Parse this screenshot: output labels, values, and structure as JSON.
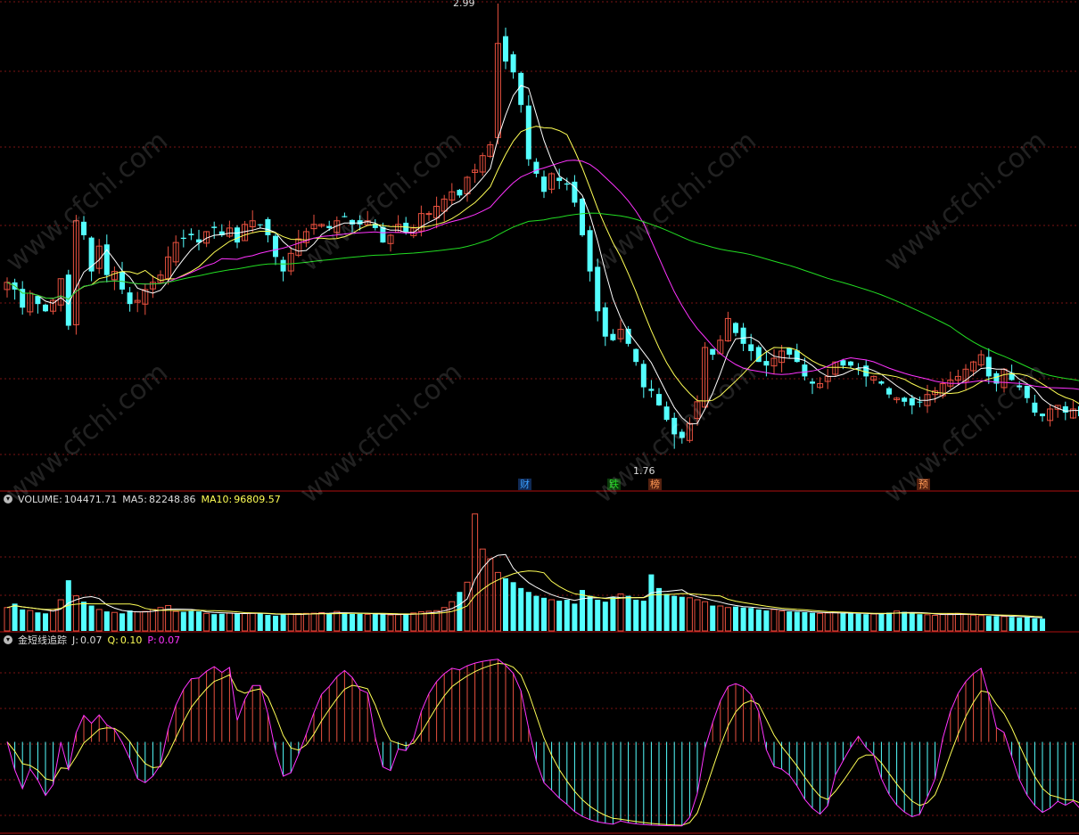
{
  "colors": {
    "up": "#e8513f",
    "down": "#54ffff",
    "ma_white": "#ffffff",
    "ma_yellow": "#ffff55",
    "ma_magenta": "#ff33ff",
    "ma_green": "#22dd22",
    "grid": "#7a1414",
    "sep": "#b01010"
  },
  "watermark": "www.cfchi.com",
  "price_panel": {
    "high_label": "2.99",
    "low_label": "1.76",
    "markers": [
      {
        "text": "财",
        "color": "#3aa0ff",
        "bg": "#102a55"
      },
      {
        "text": "跌",
        "color": "#22dd22",
        "bg": "#0b3a0b"
      },
      {
        "text": "榜",
        "color": "#ff9955",
        "bg": "#552210"
      },
      {
        "text": "预",
        "color": "#ff9955",
        "bg": "#552210"
      }
    ]
  },
  "volume_panel": {
    "name": "VOLUME:",
    "value": "104471.71",
    "ma5_label": "MA5:",
    "ma5_value": "82248.86",
    "ma10_label": "MA10:",
    "ma10_value": "96809.57"
  },
  "indicator_panel": {
    "name": "金短线追踪",
    "j_label": "J:",
    "j_value": "0.07",
    "q_label": "Q:",
    "q_value": "0.10",
    "p_label": "P:",
    "p_value": "0.07"
  },
  "chart_data": [
    {
      "type": "candlestick",
      "ylim": [
        1.7,
        3.0
      ],
      "high_annotation": 2.99,
      "low_annotation": 1.76,
      "series": [
        {
          "name": "close",
          "values": [
            2.22,
            2.2,
            2.15,
            2.19,
            2.16,
            2.14,
            2.17,
            2.23,
            2.1,
            2.39,
            2.35,
            2.25,
            2.32,
            2.24,
            2.25,
            2.2,
            2.16,
            2.17,
            2.2,
            2.22,
            2.24,
            2.29,
            2.33,
            2.34,
            2.35,
            2.33,
            2.36,
            2.37,
            2.35,
            2.37,
            2.33,
            2.38,
            2.39,
            2.38,
            2.35,
            2.29,
            2.25,
            2.3,
            2.34,
            2.36,
            2.38,
            2.38,
            2.37,
            2.39,
            2.4,
            2.38,
            2.38,
            2.39,
            2.37,
            2.33,
            2.35,
            2.38,
            2.36,
            2.37,
            2.41,
            2.41,
            2.43,
            2.45,
            2.47,
            2.46,
            2.51,
            2.53,
            2.57,
            2.6,
            2.88,
            2.83,
            2.8,
            2.71,
            2.56,
            2.52,
            2.47,
            2.52,
            2.5,
            2.49,
            2.44,
            2.35,
            2.25,
            2.14,
            2.07,
            2.06,
            2.09,
            2.05,
            2.0,
            1.93,
            1.92,
            1.88,
            1.84,
            1.8,
            1.79,
            1.83,
            1.89,
            2.04,
            2.02,
            2.06,
            2.12,
            2.08,
            2.05,
            2.03,
            2.0,
            1.99,
            2.01,
            2.03,
            2.02,
            2.0,
            1.96,
            1.94,
            1.94,
            1.96,
            2.0,
            1.99,
            1.99,
            1.98,
            1.96,
            1.96,
            1.94,
            1.91,
            1.9,
            1.89,
            1.88,
            1.89,
            1.91,
            1.92,
            1.94,
            1.95,
            1.96,
            1.98,
            2.0,
            2.02,
            1.96,
            1.94,
            1.98,
            1.95,
            1.93,
            1.9,
            1.86,
            1.85,
            1.87,
            1.88,
            1.86,
            1.87,
            1.85
          ]
        },
        {
          "name": "volume",
          "values": [
            12000,
            14000,
            11000,
            10500,
            9500,
            9000,
            11000,
            16000,
            26000,
            18000,
            15000,
            13000,
            11000,
            10000,
            9500,
            9000,
            10500,
            9800,
            10000,
            11000,
            12000,
            13000,
            10000,
            9800,
            10200,
            10000,
            9000,
            8600,
            8800,
            9200,
            9100,
            8900,
            9000,
            9300,
            8200,
            7800,
            8400,
            8800,
            8900,
            9000,
            9100,
            9400,
            9000,
            10000,
            9100,
            8700,
            8800,
            8500,
            8600,
            8700,
            8200,
            8300,
            8600,
            9200,
            9800,
            10100,
            10400,
            12000,
            15000,
            20000,
            25000,
            60000,
            42000,
            37000,
            30000,
            27000,
            25000,
            22000,
            20000,
            18000,
            17000,
            16000,
            15500,
            16000,
            14000,
            21000,
            18000,
            16000,
            15000,
            17500,
            19000,
            18000,
            16000,
            15500,
            29000,
            22000,
            19000,
            18000,
            17500,
            17000,
            16000,
            15000,
            13000,
            12800,
            12000,
            12500,
            12000,
            11800,
            11000,
            10500,
            11000,
            10200,
            10000,
            9800,
            9600,
            9300,
            9000,
            9200,
            9400,
            9100,
            8900,
            8800,
            8600,
            8700,
            9000,
            9400,
            10200,
            9800,
            9000,
            8600,
            8300,
            8000,
            8400,
            8700,
            9000,
            8400,
            8100,
            7900,
            7700,
            7600,
            7400,
            7200,
            6800,
            7000,
            6500,
            6300
          ]
        }
      ]
    },
    {
      "type": "line",
      "series": [
        {
          "name": "J",
          "values": [
            0.07
          ]
        },
        {
          "name": "Q",
          "values": [
            0.1
          ]
        },
        {
          "name": "P",
          "values": [
            0.07
          ]
        }
      ]
    }
  ]
}
